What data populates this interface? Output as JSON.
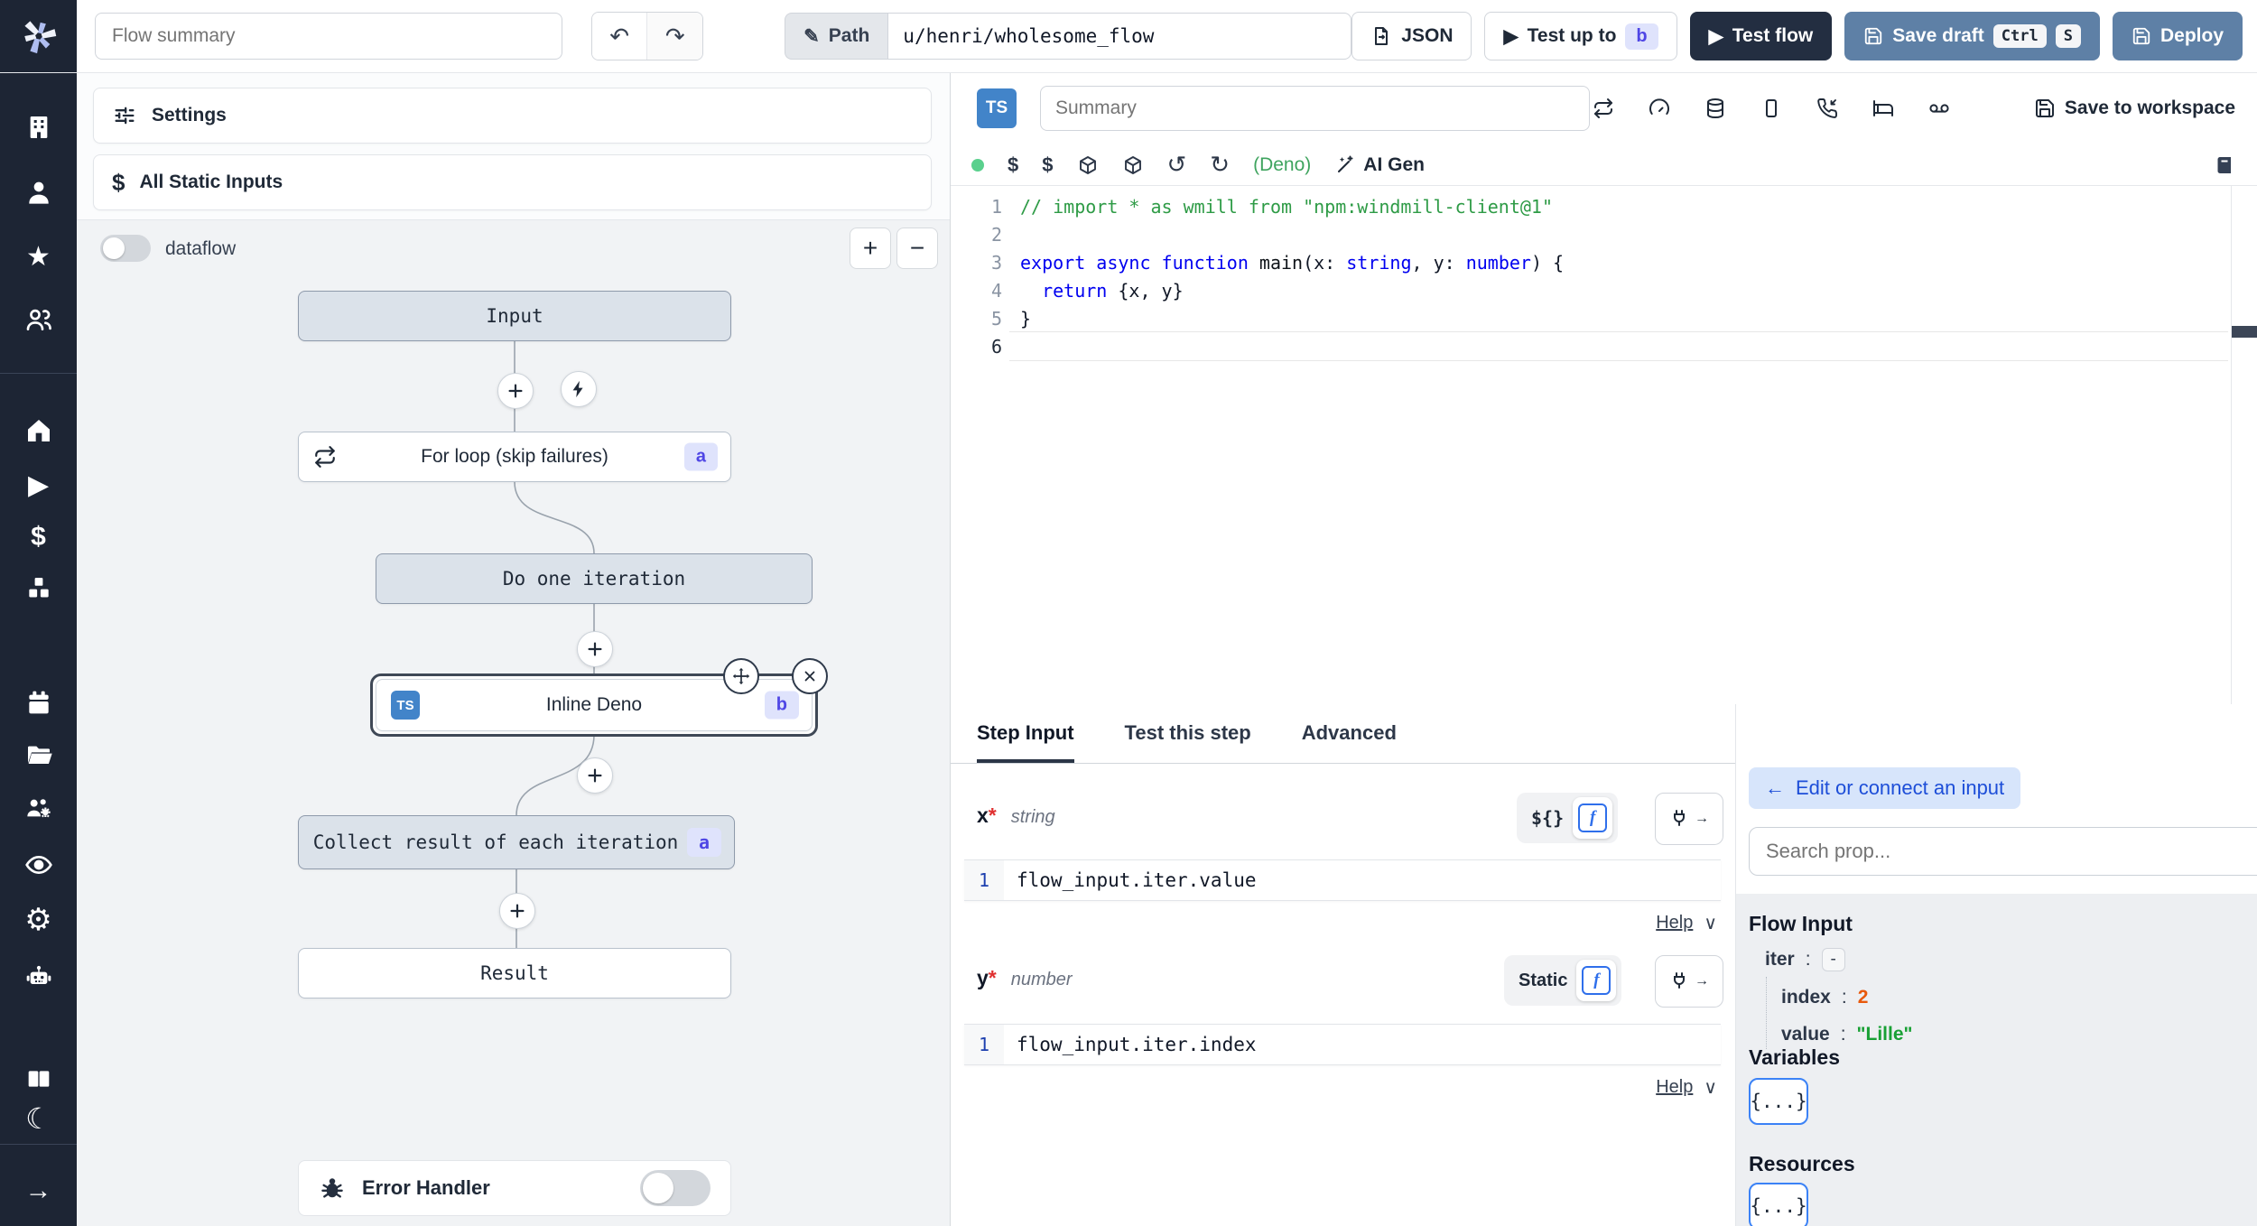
{
  "colors": {
    "sidebar_bg": "#1d2534",
    "dark_button": "#232e41",
    "steel_blue_button": "#5e80a6",
    "badge_bg": "#dfe3fc",
    "badge_text": "#4f46e5",
    "node_bg": "#dbe2ea",
    "canvas_bg": "#f1f3f5",
    "selected_node_border": "#3f4856",
    "green_status_dot": "#5ad08d",
    "deno_green": "#3fa45f",
    "comment_green": "#2e9b46",
    "keyword_blue": "#0000f0",
    "number_orange": "#e8590c",
    "string_green": "#18a034",
    "link_blue": "#1d4ed8",
    "ts_badge_blue": "#4284c9"
  },
  "glyphs": {
    "undo": "↶",
    "redo": "↷",
    "pencil": "✎",
    "play": "▶",
    "plus": "+",
    "minus": "−",
    "dollar": "$",
    "star": "★",
    "gear": "⚙",
    "moon": "☾",
    "arrow_right": "→",
    "back_arrow": "←",
    "chevron_down": "∨",
    "rotate_ccw": "↺",
    "rotate_cw": "↻"
  },
  "topbar": {
    "flow_summary_placeholder": "Flow summary",
    "path_label": "Path",
    "path_value": "u/henri/wholesome_flow",
    "json_button": "JSON",
    "test_up_to": "Test up to",
    "test_up_to_badge": "b",
    "test_flow": "Test flow",
    "save_draft": "Save draft",
    "save_draft_kbd": [
      "Ctrl",
      "S"
    ],
    "deploy": "Deploy"
  },
  "sidebar": {
    "icons": [
      "building",
      "user",
      "star",
      "users-group",
      "home",
      "play",
      "dollar",
      "cubes",
      "calendar",
      "folder-open",
      "users-gear",
      "eye",
      "gear",
      "robot",
      "book-open",
      "moon",
      "arrow-right"
    ]
  },
  "flow": {
    "settings": "Settings",
    "all_static_inputs": "All Static Inputs",
    "dataflow_label": "dataflow",
    "zoom_in": "+",
    "zoom_out": "−",
    "nodes": {
      "input": {
        "label": "Input"
      },
      "forloop": {
        "label": "For loop (skip failures)",
        "badge": "a"
      },
      "iteration": {
        "label": "Do one iteration"
      },
      "inline_deno": {
        "label": "Inline Deno",
        "badge": "b",
        "lang": "TS"
      },
      "collect": {
        "label": "Collect result of each iteration",
        "badge": "a"
      },
      "result": {
        "label": "Result"
      }
    },
    "error_handler": "Error Handler"
  },
  "editor": {
    "lang_badge": "TS",
    "summary_placeholder": "Summary",
    "save_to_workspace": "Save to workspace",
    "runtime": "(Deno)",
    "ai_gen": "AI Gen",
    "line_numbers": [
      "1",
      "2",
      "3",
      "4",
      "5",
      "6"
    ],
    "code": {
      "l1": "// import * as wmill from \"npm:windmill-client@1\"",
      "l3_kw": "export async function ",
      "l3_fn": "main",
      "l3_a": "(x: ",
      "l3_t1": "string",
      "l3_b": ", y: ",
      "l3_t2": "number",
      "l3_c": ") {",
      "l4_kw": "  return",
      "l4_rest": " {x, y}",
      "l5": "}"
    }
  },
  "step_panel": {
    "tabs": [
      "Step Input",
      "Test this step",
      "Advanced"
    ],
    "active_tab": "Step Input",
    "fields": [
      {
        "name": "x",
        "required": "*",
        "type": "string",
        "mode_label": "${}",
        "line_no": "1",
        "expr": "flow_input.iter.value",
        "help": "Help"
      },
      {
        "name": "y",
        "required": "*",
        "type": "number",
        "mode_label": "Static",
        "line_no": "1",
        "expr": "flow_input.iter.index",
        "help": "Help"
      }
    ]
  },
  "prop_picker": {
    "edit_connect": "Edit or connect an input",
    "search_placeholder": "Search prop...",
    "flow_input_title": "Flow Input",
    "colon": ":",
    "rows": [
      {
        "key": "iter",
        "value": "-"
      },
      {
        "key": "index",
        "value": "2"
      },
      {
        "key": "value",
        "value": "\"Lille\""
      }
    ],
    "variables_title": "Variables",
    "resources_title": "Resources",
    "object_chip": "{...}"
  }
}
